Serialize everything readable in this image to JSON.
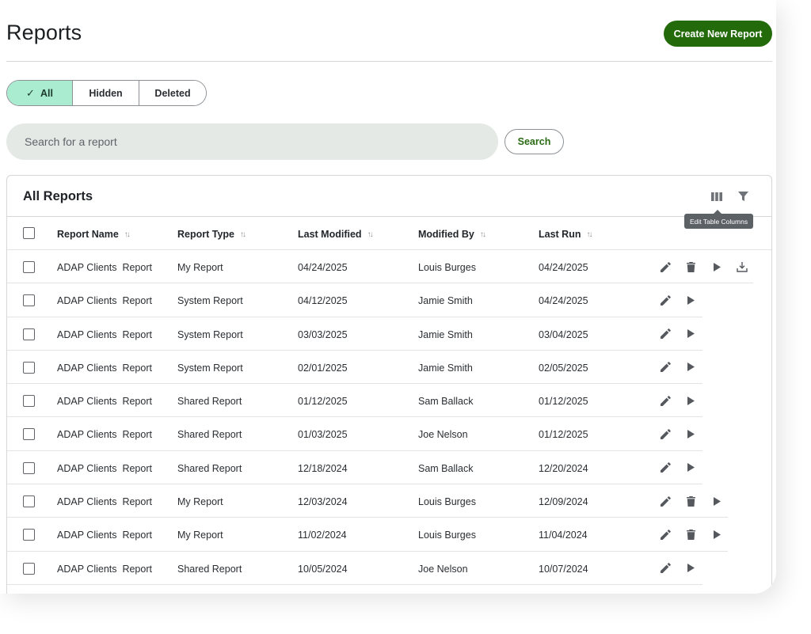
{
  "header": {
    "title": "Reports",
    "create_label": "Create New Report"
  },
  "filters": [
    {
      "label": "All",
      "active": true
    },
    {
      "label": "Hidden",
      "active": false
    },
    {
      "label": "Deleted",
      "active": false
    }
  ],
  "search": {
    "placeholder": "Search for a report",
    "button_label": "Search"
  },
  "table": {
    "title": "All Reports",
    "tooltip": "Edit Table Columns",
    "toolbar_icons": [
      "columns-icon",
      "filter-icon"
    ],
    "columns": [
      "Report Name",
      "Report Type",
      "Last Modified",
      "Modified By",
      "Last Run"
    ],
    "rows": [
      {
        "name": "ADAP Clients  Report",
        "type": "My Report",
        "modified": "04/24/2025",
        "by": "Louis Burges",
        "run": "04/24/2025",
        "actions": [
          "edit",
          "delete",
          "run",
          "download"
        ]
      },
      {
        "name": "ADAP Clients  Report",
        "type": "System Report",
        "modified": "04/12/2025",
        "by": "Jamie Smith",
        "run": "04/24/2025",
        "actions": [
          "edit",
          "run"
        ]
      },
      {
        "name": "ADAP Clients  Report",
        "type": "System Report",
        "modified": "03/03/2025",
        "by": "Jamie Smith",
        "run": "03/04/2025",
        "actions": [
          "edit",
          "run"
        ]
      },
      {
        "name": "ADAP Clients  Report",
        "type": "System Report",
        "modified": "02/01/2025",
        "by": "Jamie Smith",
        "run": "02/05/2025",
        "actions": [
          "edit",
          "run"
        ]
      },
      {
        "name": "ADAP Clients  Report",
        "type": "Shared Report",
        "modified": "01/12/2025",
        "by": "Sam Ballack",
        "run": "01/12/2025",
        "actions": [
          "edit",
          "run"
        ]
      },
      {
        "name": "ADAP Clients  Report",
        "type": "Shared Report",
        "modified": "01/03/2025",
        "by": "Joe Nelson",
        "run": "01/12/2025",
        "actions": [
          "edit",
          "run"
        ]
      },
      {
        "name": "ADAP Clients  Report",
        "type": "Shared Report",
        "modified": "12/18/2024",
        "by": "Sam Ballack",
        "run": "12/20/2024",
        "actions": [
          "edit",
          "run"
        ]
      },
      {
        "name": "ADAP Clients  Report",
        "type": "My Report",
        "modified": "12/03/2024",
        "by": "Louis Burges",
        "run": "12/09/2024",
        "actions": [
          "edit",
          "delete",
          "run"
        ]
      },
      {
        "name": "ADAP Clients  Report",
        "type": "My Report",
        "modified": "11/02/2024",
        "by": "Louis Burges",
        "run": "11/04/2024",
        "actions": [
          "edit",
          "delete",
          "run"
        ]
      },
      {
        "name": "ADAP Clients  Report",
        "type": "Shared Report",
        "modified": "10/05/2024",
        "by": "Joe Nelson",
        "run": "10/07/2024",
        "actions": [
          "edit",
          "run"
        ]
      }
    ]
  },
  "colors": {
    "primary": "#236a0b",
    "active_filter": "#a9ecd0",
    "search_bg": "#e4e9e6",
    "icon": "#5f6368"
  }
}
